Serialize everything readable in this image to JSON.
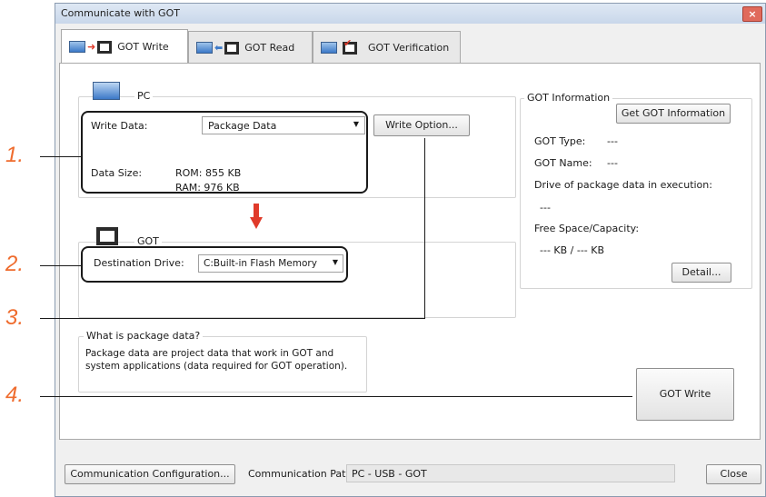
{
  "window": {
    "title": "Communicate with GOT",
    "close_glyph": "×"
  },
  "tabs": [
    {
      "label": "GOT Write",
      "active": true,
      "icon": "pc-to-got-icon"
    },
    {
      "label": "GOT Read",
      "active": false,
      "icon": "got-to-pc-icon"
    },
    {
      "label": "GOT Verification",
      "active": false,
      "icon": "verify-icon"
    }
  ],
  "pc_group": {
    "legend": "PC",
    "write_data_label": "Write Data:",
    "write_data_value": "Package Data",
    "write_option_button": "Write Option...",
    "data_size_label": "Data Size:",
    "rom": "ROM: 855 KB",
    "ram": "RAM: 976 KB"
  },
  "got_group": {
    "legend": "GOT",
    "destination_label": "Destination Drive:",
    "destination_value": "C:Built-in Flash Memory"
  },
  "package_info": {
    "legend": "What is package data?",
    "line1": "Package data are project data that work in GOT and",
    "line2": "system applications (data required for GOT operation)."
  },
  "got_info": {
    "legend": "GOT Information",
    "get_button": "Get GOT Information",
    "type_label": "GOT Type:",
    "type_value": "---",
    "name_label": "GOT Name:",
    "name_value": "---",
    "drive_label": "Drive of package data in execution:",
    "drive_value": "---",
    "free_label": "Free Space/Capacity:",
    "free_value": "--- KB / --- KB",
    "detail_button": "Detail..."
  },
  "got_write_button": "GOT Write",
  "footer": {
    "comm_config_button": "Communication Configuration...",
    "path_label": "Communication Path:",
    "path_value": "PC - USB - GOT",
    "close_button": "Close"
  },
  "callouts": [
    "1.",
    "2.",
    "3.",
    "4."
  ],
  "colors": {
    "callout": "#ef6c2e",
    "arrow": "#e03a2a",
    "monitor": "#3c79c8"
  }
}
